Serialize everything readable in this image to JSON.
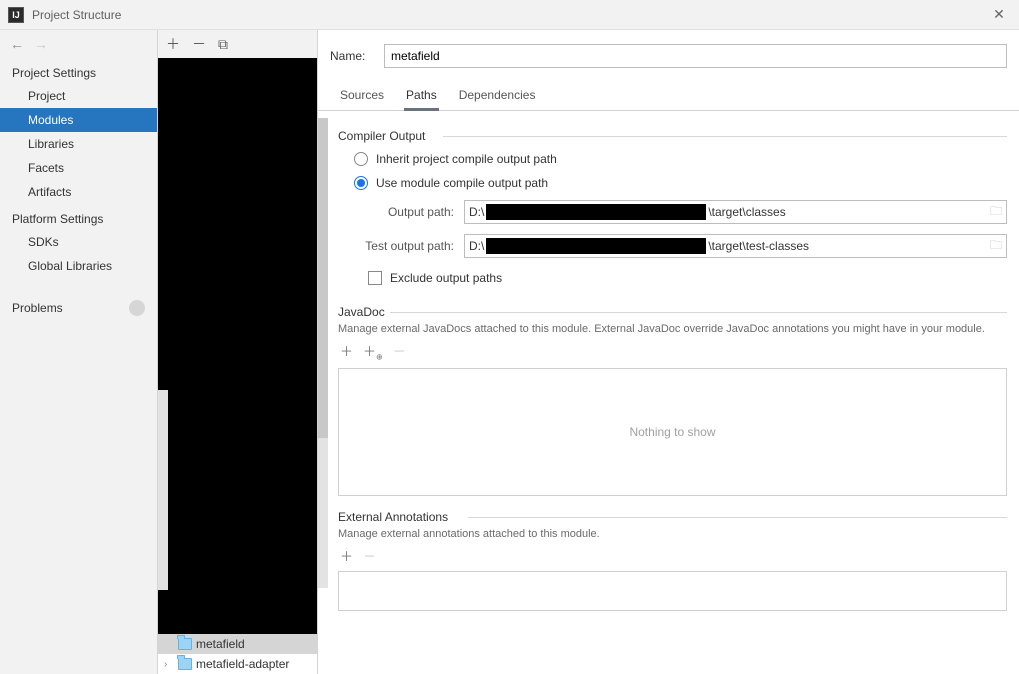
{
  "window": {
    "title": "Project Structure"
  },
  "sidebar": {
    "sections": [
      {
        "title": "Project Settings",
        "items": [
          "Project",
          "Modules",
          "Libraries",
          "Facets",
          "Artifacts"
        ],
        "selectedIndex": 1
      },
      {
        "title": "Platform Settings",
        "items": [
          "SDKs",
          "Global Libraries"
        ]
      }
    ],
    "problems": {
      "label": "Problems"
    }
  },
  "modules": {
    "tree": [
      {
        "label": "metafield",
        "selected": true,
        "expandable": false
      },
      {
        "label": "metafield-adapter",
        "selected": false,
        "expandable": true
      }
    ]
  },
  "form": {
    "nameLabel": "Name:",
    "nameValue": "metafield",
    "tabs": [
      "Sources",
      "Paths",
      "Dependencies"
    ],
    "activeTab": 1
  },
  "compiler": {
    "title": "Compiler Output",
    "inheritLabel": "Inherit project compile output path",
    "useModuleLabel": "Use module compile output path",
    "selected": "useModule",
    "outputLabel": "Output path:",
    "outputPathPrefix": "D:\\",
    "outputPathSuffix": "\\target\\classes",
    "testOutputLabel": "Test output path:",
    "testOutputPrefix": "D:\\",
    "testOutputSuffix": "\\target\\test-classes",
    "excludeLabel": "Exclude output paths"
  },
  "javadoc": {
    "title": "JavaDoc",
    "desc": "Manage external JavaDocs attached to this module. External JavaDoc override JavaDoc annotations you might have in your module.",
    "empty": "Nothing to show"
  },
  "extann": {
    "title": "External Annotations",
    "desc": "Manage external annotations attached to this module."
  }
}
